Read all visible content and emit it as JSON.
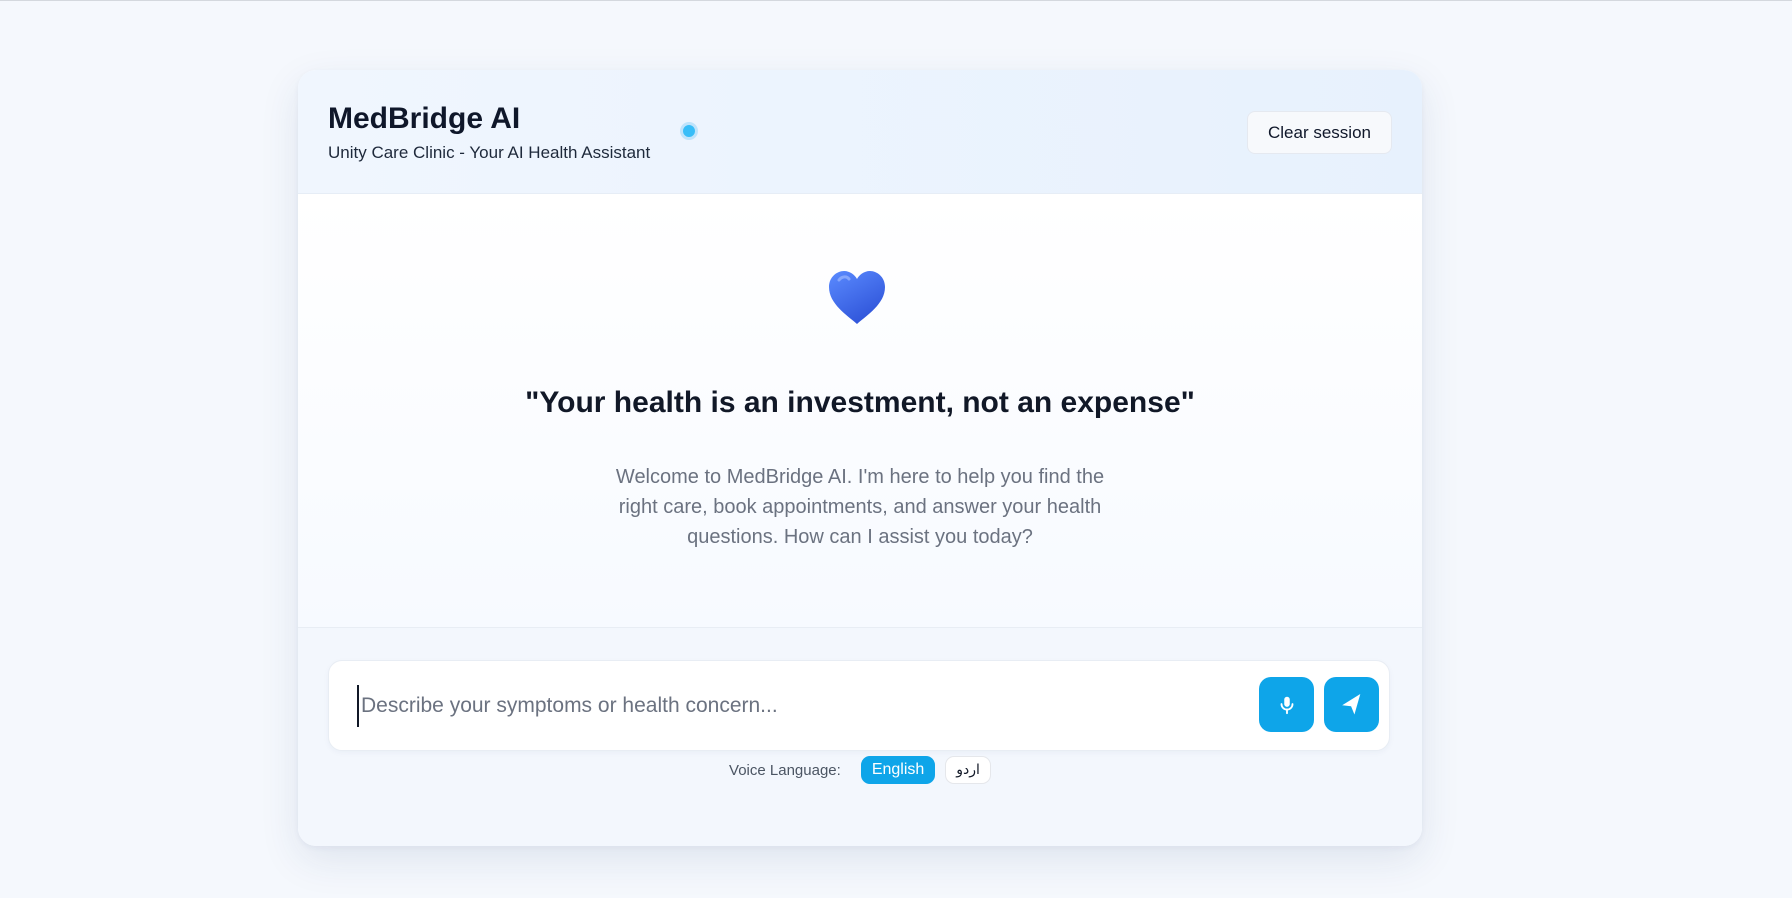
{
  "header": {
    "title": "MedBridge AI",
    "subtitle": "Unity Care Clinic - Your AI Health Assistant",
    "clear_label": "Clear session"
  },
  "welcome": {
    "icon": "heart-icon",
    "quote": "\"Your health is an investment, not an expense\"",
    "message": "Welcome to MedBridge AI. I'm here to help you find the right care, book appointments, and answer your health questions. How can I assist you today?"
  },
  "composer": {
    "value": "",
    "placeholder": "Describe your symptoms or health concern...",
    "mic_icon": "microphone-icon",
    "send_icon": "send-icon"
  },
  "voice": {
    "label": "Voice Language:",
    "options": [
      {
        "label": "English",
        "selected": true
      },
      {
        "label": "اردو",
        "selected": false
      }
    ]
  },
  "colors": {
    "accent": "#0ea5e9",
    "heart": "#3b6cf0",
    "status_dot": "#38bdf8"
  }
}
